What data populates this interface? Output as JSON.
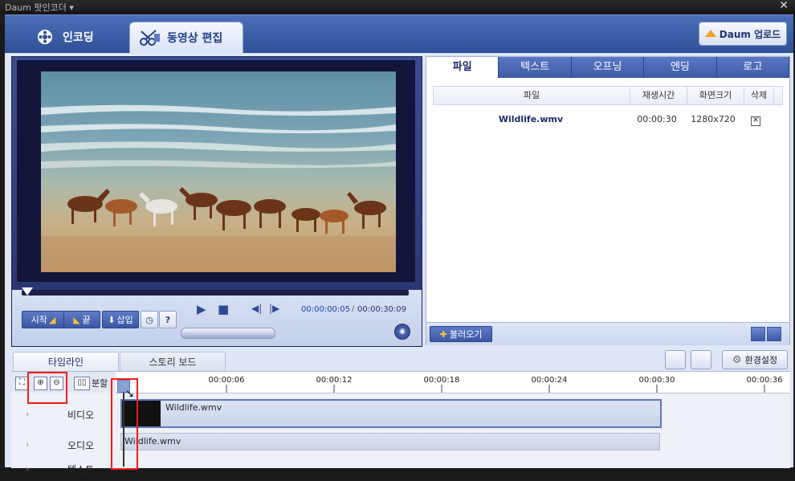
{
  "window": {
    "title": "Daum 팟인코더 ▾",
    "close": "✕"
  },
  "main_tabs": [
    {
      "label": "인코딩"
    },
    {
      "label": "동영상 편집"
    }
  ],
  "upload_button": "Daum 업로드",
  "player": {
    "start_label": "시작",
    "end_label": "끝",
    "insert_label": "삽입",
    "help_label": "?",
    "current_time": "00:00:00:05",
    "total_time": "00:00:30:09",
    "progress": 0.0
  },
  "right_panel": {
    "tabs": [
      "파일",
      "텍스트",
      "오프닝",
      "엔딩",
      "로고"
    ],
    "active_tab": "파일",
    "columns": [
      "파일",
      "재생시간",
      "화면크기",
      "삭제"
    ],
    "rows": [
      {
        "file": "Wildlife.wmv",
        "duration": "00:00:30",
        "size": "1280x720",
        "delete": "✕"
      }
    ],
    "load_button": "불러오기"
  },
  "timeline": {
    "tabs": [
      "타임라인",
      "스토리 보드"
    ],
    "settings_button": "환경설정",
    "split_label": "분할",
    "ticks": [
      "00:00:06",
      "00:00:12",
      "00:00:18",
      "00:00:24",
      "00:00:30",
      "00:00:36"
    ],
    "lanes": [
      "비디오",
      "오디오",
      "텍스트"
    ],
    "video_clip": "Wildlife.wmv",
    "audio_clip": "Wildlife.wmv"
  },
  "colors": {
    "accent": "#3e5aa6",
    "highlight": "#ff1a1a"
  }
}
